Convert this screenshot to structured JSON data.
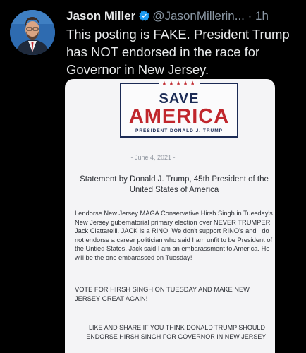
{
  "tweet": {
    "author_name": "Jason Miller",
    "handle": "@JasonMillerin...",
    "separator": "·",
    "time": "1h",
    "text": "This posting is FAKE. President Trump has NOT endorsed in the race for Governor in New Jersey.",
    "verified_icon": "verified-badge-icon",
    "accent_color": "#1d9bf0"
  },
  "embedded_image": {
    "logo": {
      "stars": "★★★★★",
      "line1": "SAVE",
      "line2": "AMERICA",
      "line3": "PRESIDENT DONALD J. TRUMP",
      "red": "#c0262c",
      "navy": "#1c2b55"
    },
    "date": "- June 4, 2021 -",
    "statement_title": "Statement by Donald J. Trump, 45th President of the United States of America",
    "body": "I endorse New Jersey MAGA Conservative Hirsh Singh in Tuesday's New Jersey gubernatorial primary election over NEVER TRUMPER Jack Ciattarelli.  JACK is a RINO.  We don't support RINO's and I do not endorse a career politician who said I am unfit to be President of the Untied States.  Jack said I am an embarassment to America. He will be the one embarassed on Tuesday!",
    "vote": "VOTE FOR HIRSH SINGH ON TUESDAY AND MAKE NEW JERSEY GREAT AGAIN!",
    "share": "LIKE AND SHARE IF YOU THINK DONALD TRUMP SHOULD ENDORSE HIRSH SINGH FOR GOVERNOR IN NEW JERSEY!"
  }
}
